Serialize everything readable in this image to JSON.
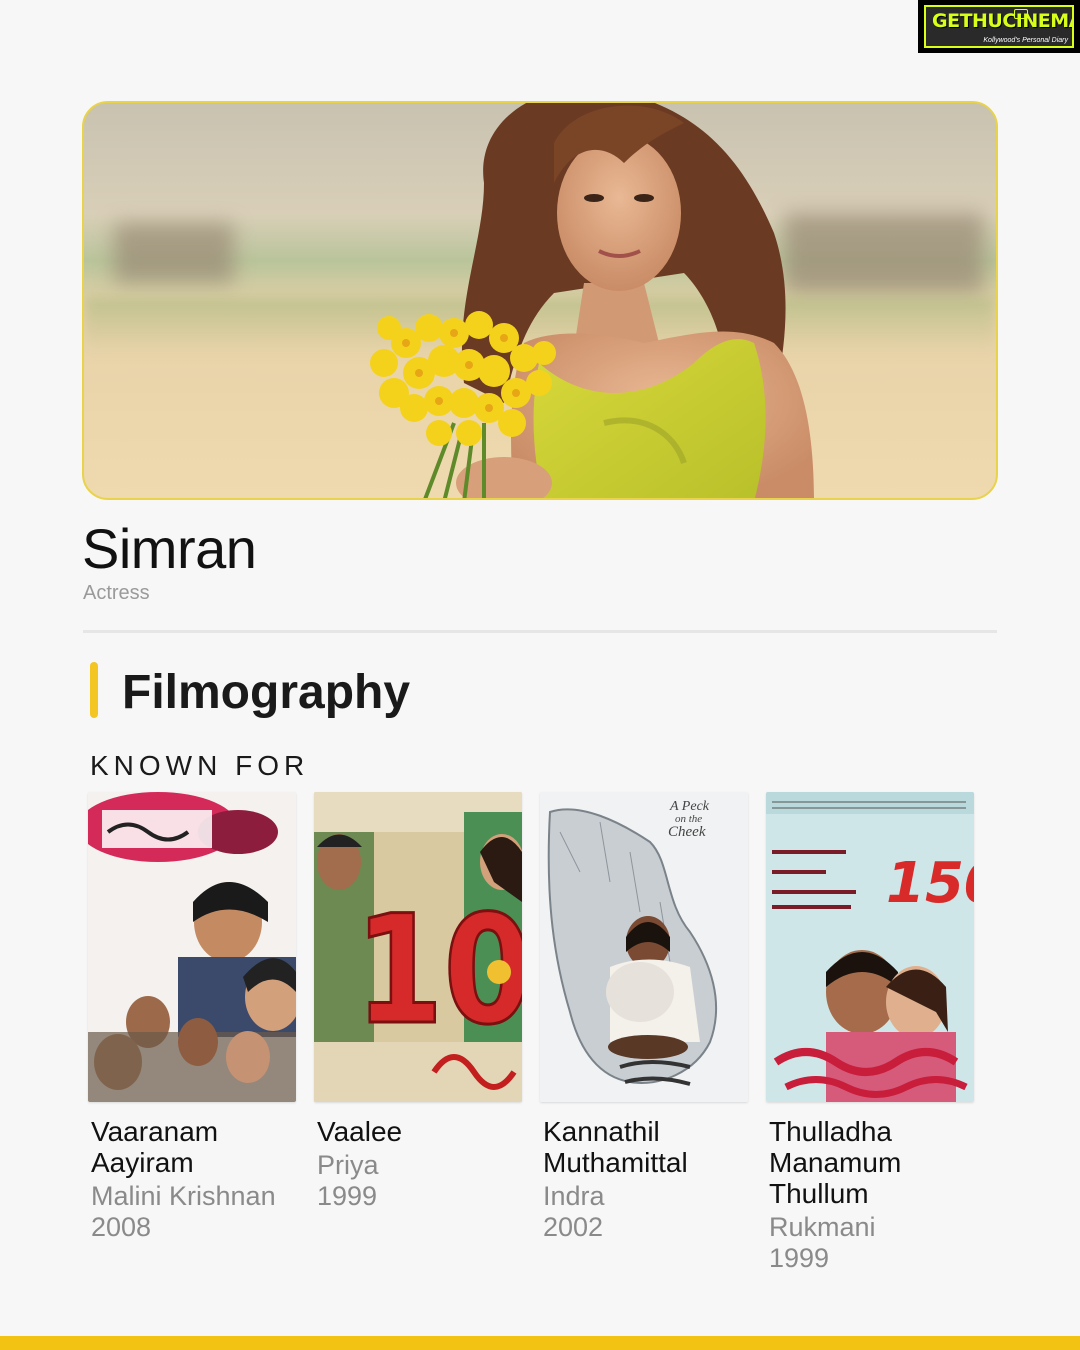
{
  "logo": {
    "wordmark": "GETHUCINEMA",
    "tagline": "Kollywood's Personal Diary"
  },
  "profile": {
    "name": "Simran",
    "role": "Actress"
  },
  "section": {
    "title": "Filmography",
    "subtitle": "KNOWN FOR"
  },
  "films": [
    {
      "title": "Vaaranam Aayiram",
      "role": "Malini Krishnan",
      "year": "2008"
    },
    {
      "title": "Vaalee",
      "role": "Priya",
      "year": "1999"
    },
    {
      "title": "Kannathil Muthamittal",
      "role": "Indra",
      "year": "2002"
    },
    {
      "title": "Thulladha Manamum Thullum",
      "role": "Rukmani",
      "year": "1999"
    }
  ],
  "colors": {
    "accent": "#f3c623",
    "background": "#f7f7f7",
    "muted_text": "#8a8a8a"
  }
}
